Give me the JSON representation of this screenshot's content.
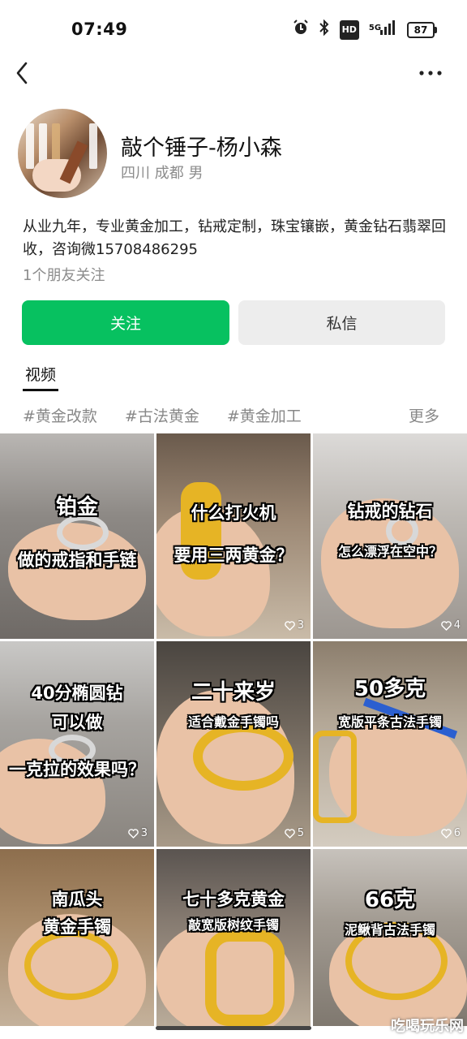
{
  "status_bar": {
    "time": "07:49",
    "hd": "HD",
    "signal_label": "5G",
    "battery": "87"
  },
  "profile": {
    "name": "敲个锤子-杨小森",
    "meta": "四川 成都 男",
    "bio": "从业九年，专业黄金加工，钻戒定制，珠宝镶嵌，黄金钻石翡翠回收，咨询微15708486295",
    "friends": "1个朋友关注"
  },
  "actions": {
    "follow": "关注",
    "message": "私信"
  },
  "tabs": {
    "videos": "视频"
  },
  "hashtags": {
    "items": [
      "#黄金改款",
      "#古法黄金",
      "#黄金加工"
    ],
    "more": "更多"
  },
  "videos": [
    {
      "line1": "铂金",
      "line2": "做的戒指和手链",
      "line3": "",
      "likes": ""
    },
    {
      "line1": "什么打火机",
      "line2": "要用三两黄金？",
      "line3": "",
      "likes": "3"
    },
    {
      "line1": "钻戒的钻石",
      "line2": "怎么漂浮在空中？",
      "line3": "",
      "likes": "4"
    },
    {
      "line1": "40分椭圆钻",
      "line2": "可以做",
      "line3": "一克拉的效果吗？",
      "likes": "3"
    },
    {
      "line1": "二十来岁",
      "line2": "适合戴金手镯吗",
      "line3": "",
      "likes": "5"
    },
    {
      "line1": "50多克",
      "line2": "宽版平条古法手镯",
      "line3": "",
      "likes": "6"
    },
    {
      "line1": "南瓜头",
      "line2": "黄金手镯",
      "line3": "",
      "likes": ""
    },
    {
      "line1": "七十多克黄金",
      "line2": "敲宽版树纹手镯",
      "line3": "",
      "likes": ""
    },
    {
      "line1": "66克",
      "line2": "泥鳅背古法手镯",
      "line3": "",
      "likes": ""
    }
  ],
  "watermark": "吃喝玩乐网"
}
